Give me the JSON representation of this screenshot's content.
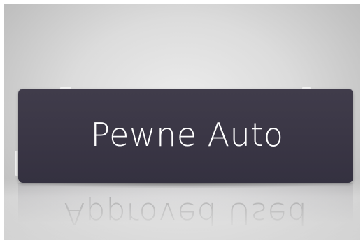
{
  "sign": {
    "text": "Pewne Auto",
    "plate_color": "#3a3645",
    "text_color": "#ffffff"
  },
  "reflection": {
    "text": "Approved Used"
  }
}
